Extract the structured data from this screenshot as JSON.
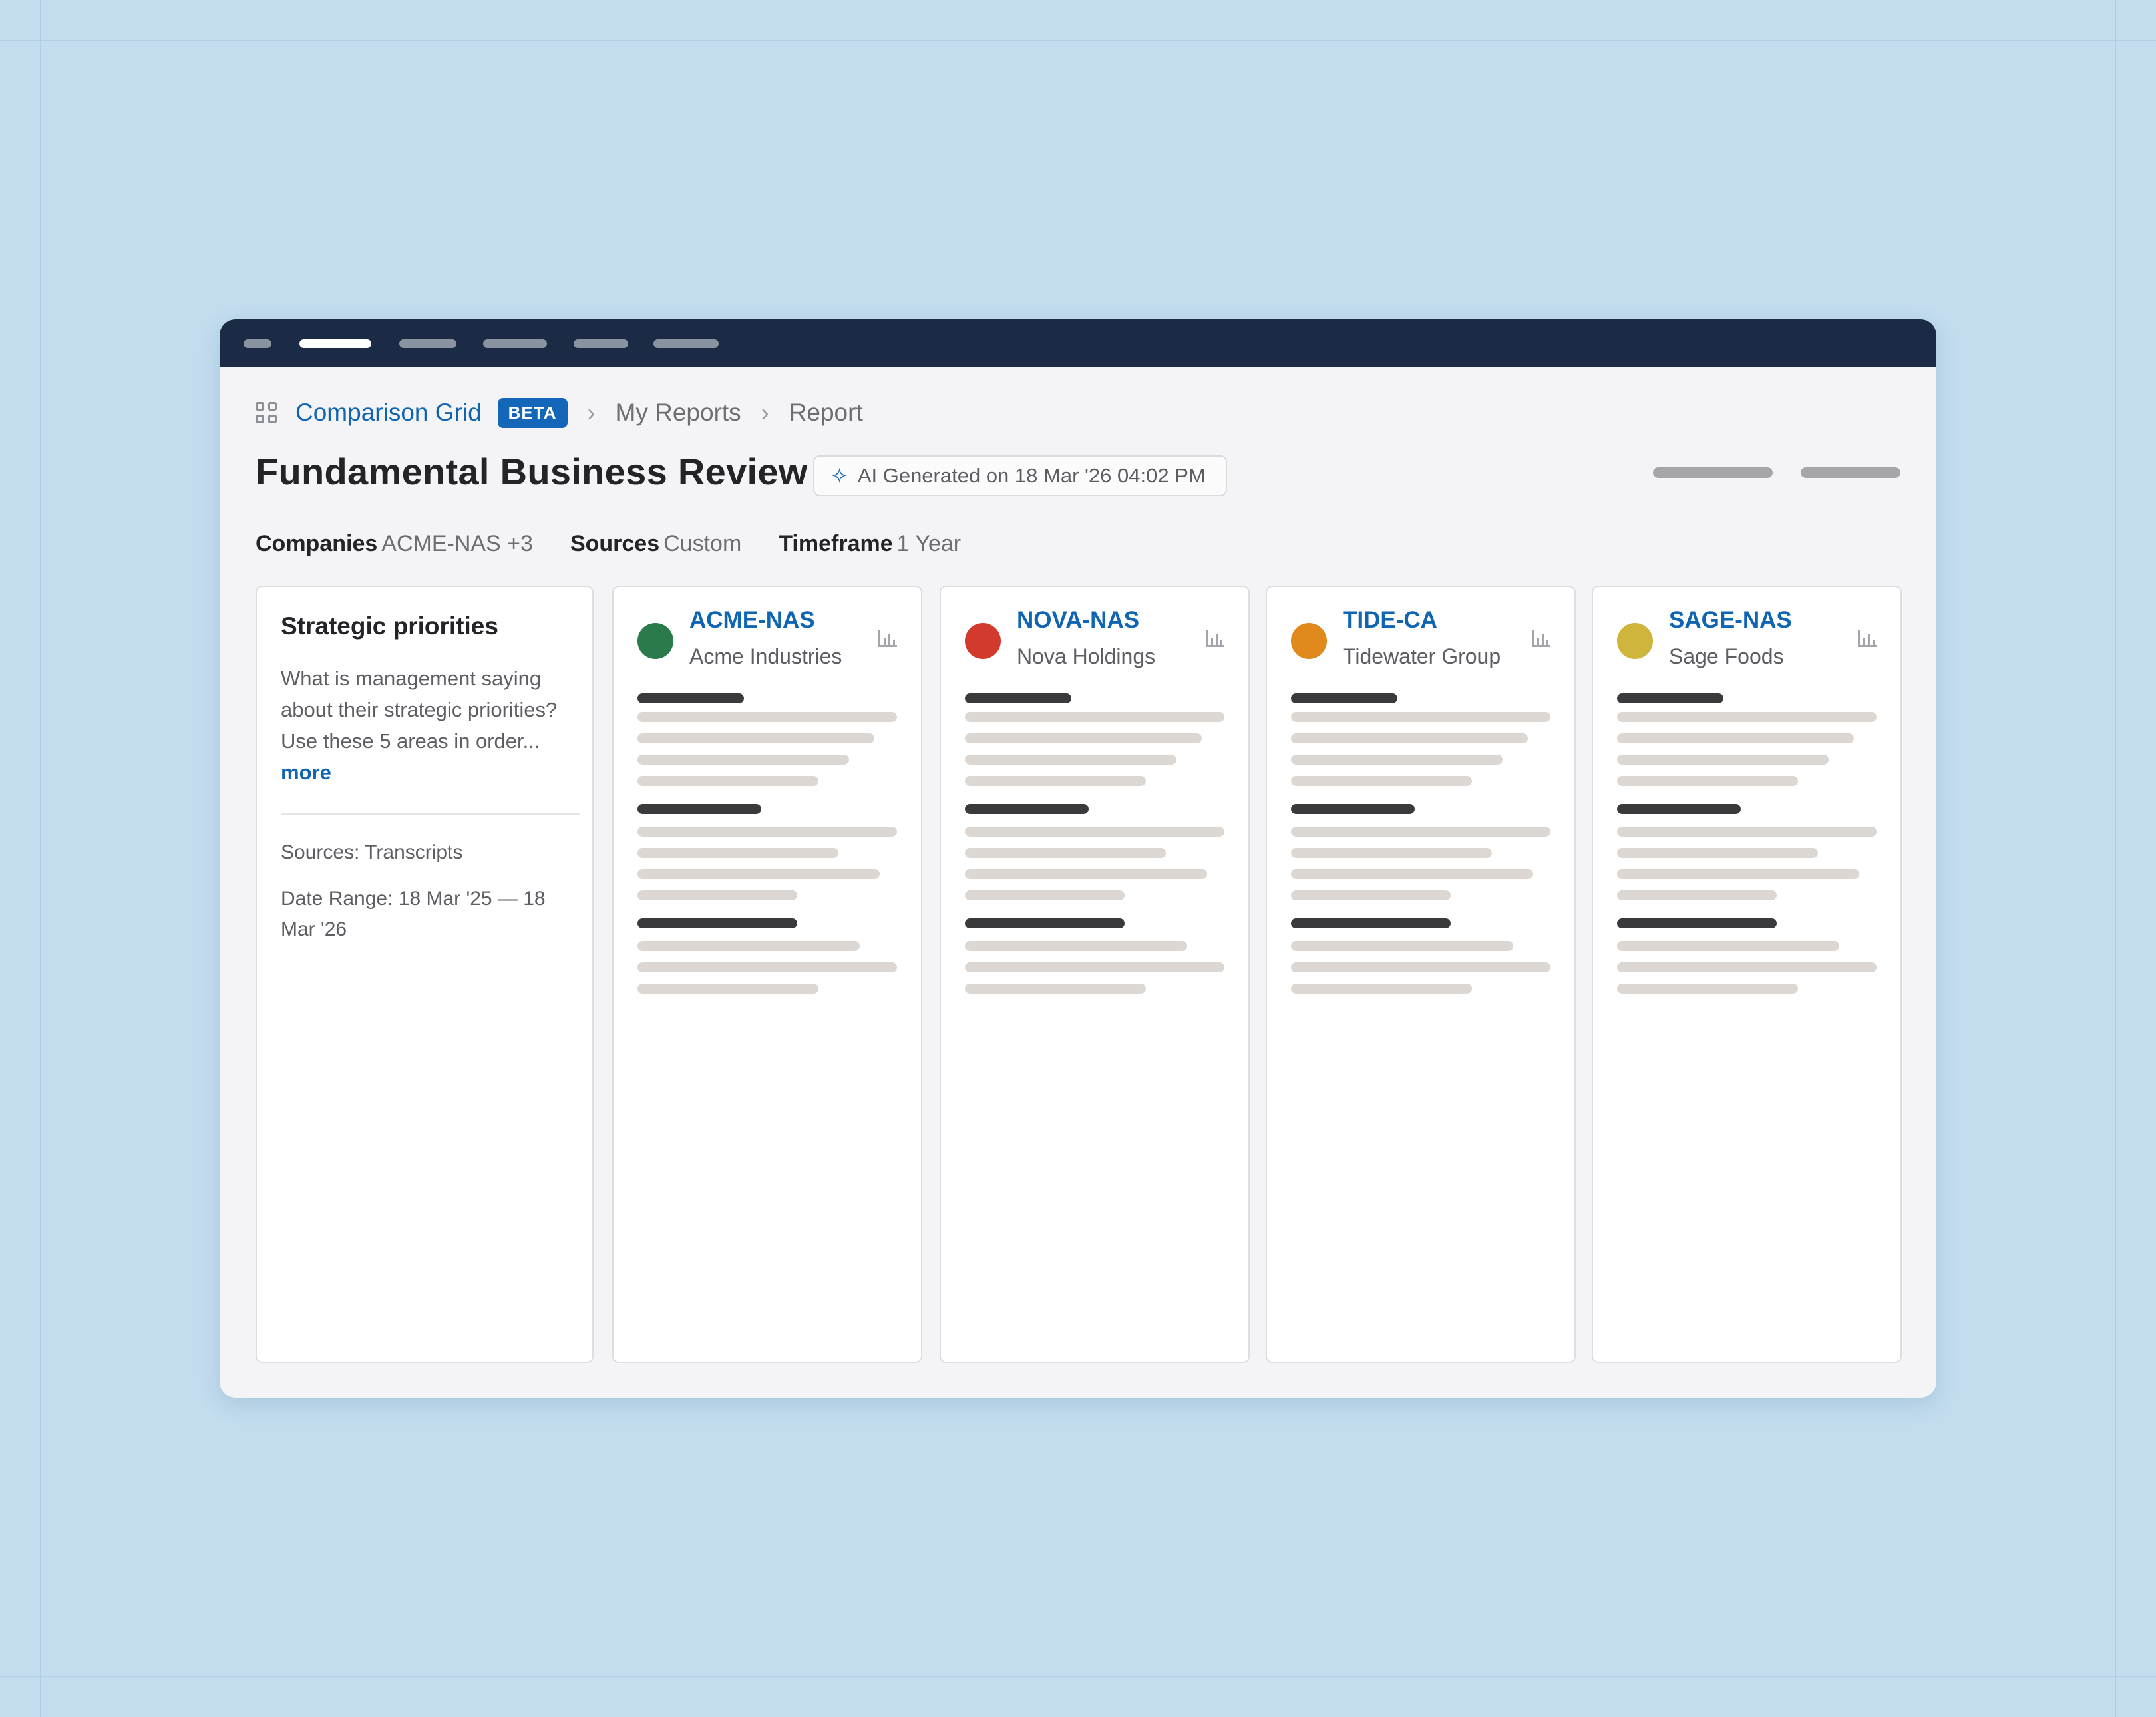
{
  "breadcrumb": {
    "app_label": "Comparison Grid",
    "badge": "BETA",
    "items": [
      "My Reports",
      "Report"
    ]
  },
  "report": {
    "title": "Fundamental Business Review",
    "ai_badge": "AI Generated on 18 Mar '26 04:02 PM"
  },
  "meta": {
    "companies_label": "Companies",
    "companies_value": "ACME-NAS +3",
    "sources_label": "Sources",
    "sources_value": "Custom",
    "timeframe_label": "Timeframe",
    "timeframe_value": "1 Year"
  },
  "question": {
    "title": "Strategic priorities",
    "text": "What is management saying about their strategic priorities? Use these 5 areas in order...",
    "more": "more",
    "sources": "Sources: Transcripts",
    "date_range": "Date Range: 18 Mar '25 — 18 Mar '26"
  },
  "companies": [
    {
      "ticker": "ACME-NAS",
      "name": "Acme Industries",
      "color": "#2b7a4b"
    },
    {
      "ticker": "NOVA-NAS",
      "name": "Nova Holdings",
      "color": "#d33a2e"
    },
    {
      "ticker": "TIDE-CA",
      "name": "Tidewater Group",
      "color": "#e08a1e"
    },
    {
      "ticker": "SAGE-NAS",
      "name": "Sage Foods",
      "color": "#cfb53b"
    }
  ],
  "icons": {
    "app": "grid-icon",
    "ai": "sparkle-icon",
    "chart": "bar-chart-icon",
    "separator": "chevron-right-icon"
  }
}
